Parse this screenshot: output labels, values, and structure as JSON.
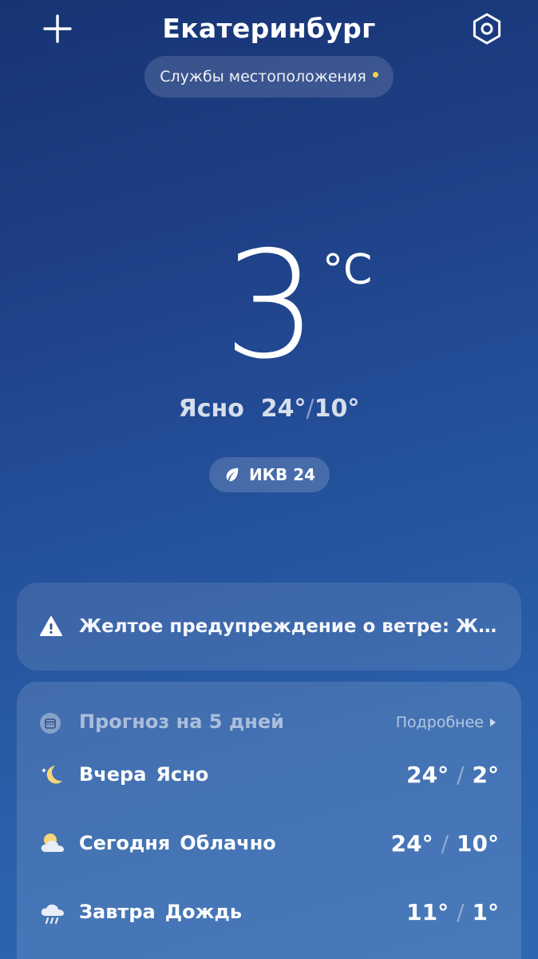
{
  "header": {
    "city": "Екатеринбург",
    "add_icon": "plus-icon",
    "settings_icon": "settings-hexagon-icon"
  },
  "location": {
    "label": "Службы местоположения",
    "dot_color": "#f5d34a"
  },
  "current": {
    "temperature": "3",
    "unit": "°C",
    "condition": "Ясно",
    "high": "24°",
    "low": "10°",
    "separator": "/"
  },
  "aqi": {
    "label": "ИКВ 24",
    "icon": "leaf-icon"
  },
  "alert": {
    "icon": "warning-triangle-icon",
    "text": "Желтое предупреждение о ветре: Же..."
  },
  "forecast": {
    "title": "Прогноз на 5 дней",
    "more_label": "Подробнее",
    "days": [
      {
        "day": "Вчера",
        "condition": "Ясно",
        "high": "24°",
        "low": "2°",
        "icon": "moon-night-icon"
      },
      {
        "day": "Сегодня",
        "condition": "Облачно",
        "high": "24°",
        "low": "10°",
        "icon": "partly-cloudy-icon"
      },
      {
        "day": "Завтра",
        "condition": "Дождь",
        "high": "11°",
        "low": "1°",
        "icon": "rain-cloud-icon"
      }
    ]
  },
  "colors": {
    "background_top": "#173474",
    "background_bottom": "#2f68b2",
    "accent_yellow": "#f5d34a"
  }
}
